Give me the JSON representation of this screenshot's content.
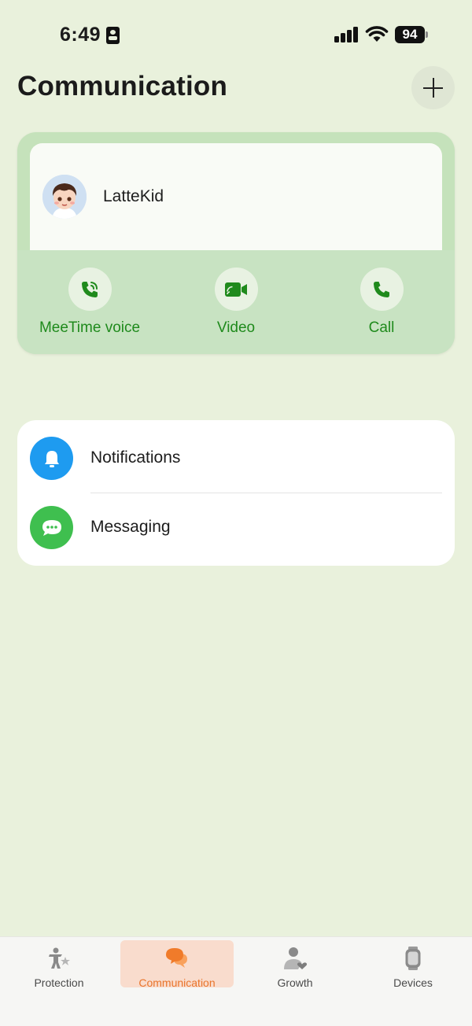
{
  "status_bar": {
    "time": "6:49",
    "battery": "94",
    "icons": [
      "contact-card-icon",
      "signal-icon",
      "wifi-icon",
      "battery-icon"
    ]
  },
  "header": {
    "title": "Communication",
    "add_icon": "plus-icon"
  },
  "contact": {
    "name": "LatteKid",
    "avatar_icon": "cartoon-boy-avatar",
    "actions": [
      {
        "label": "MeeTime voice",
        "icon": "voice-call-icon"
      },
      {
        "label": "Video",
        "icon": "video-camera-icon"
      },
      {
        "label": "Call",
        "icon": "phone-icon"
      }
    ]
  },
  "features": [
    {
      "label": "Notifications",
      "icon": "bell-icon",
      "color": "#1e9bf0"
    },
    {
      "label": "Messaging",
      "icon": "chat-bubble-icon",
      "color": "#3fbf4f"
    }
  ],
  "bottom_nav": {
    "active": "Communication",
    "items": [
      {
        "label": "Protection",
        "icon": "protection-icon"
      },
      {
        "label": "Communication",
        "icon": "chat-icon"
      },
      {
        "label": "Growth",
        "icon": "growth-icon"
      },
      {
        "label": "Devices",
        "icon": "watch-icon"
      }
    ]
  },
  "colors": {
    "background": "#e9f1dc",
    "accent_green": "#1f8a1c",
    "active_tab": "#e8752c"
  }
}
